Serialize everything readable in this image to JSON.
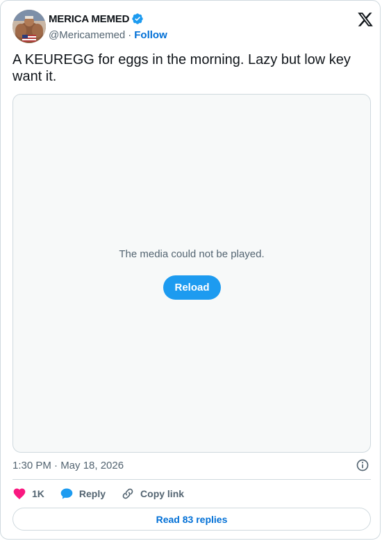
{
  "author": {
    "display_name": "MERICA MEMED",
    "handle": "@Mericamemed",
    "separator": "·",
    "follow_label": "Follow",
    "verified": true
  },
  "tweet": {
    "text": "A KEUREGG for eggs in the morning. Lazy but low key want it."
  },
  "media": {
    "error_message": "The media could not be played.",
    "reload_label": "Reload"
  },
  "meta": {
    "timestamp": "1:30 PM · May 18, 2026"
  },
  "actions": {
    "like_count": "1K",
    "reply_label": "Reply",
    "copy_label": "Copy link"
  },
  "footer": {
    "read_replies_label": "Read 83 replies"
  },
  "colors": {
    "brand_blue": "#1d9bf0",
    "link_blue": "#006fd6",
    "like_pink": "#f91880",
    "secondary_text": "#536471",
    "border": "#cfd9de"
  }
}
